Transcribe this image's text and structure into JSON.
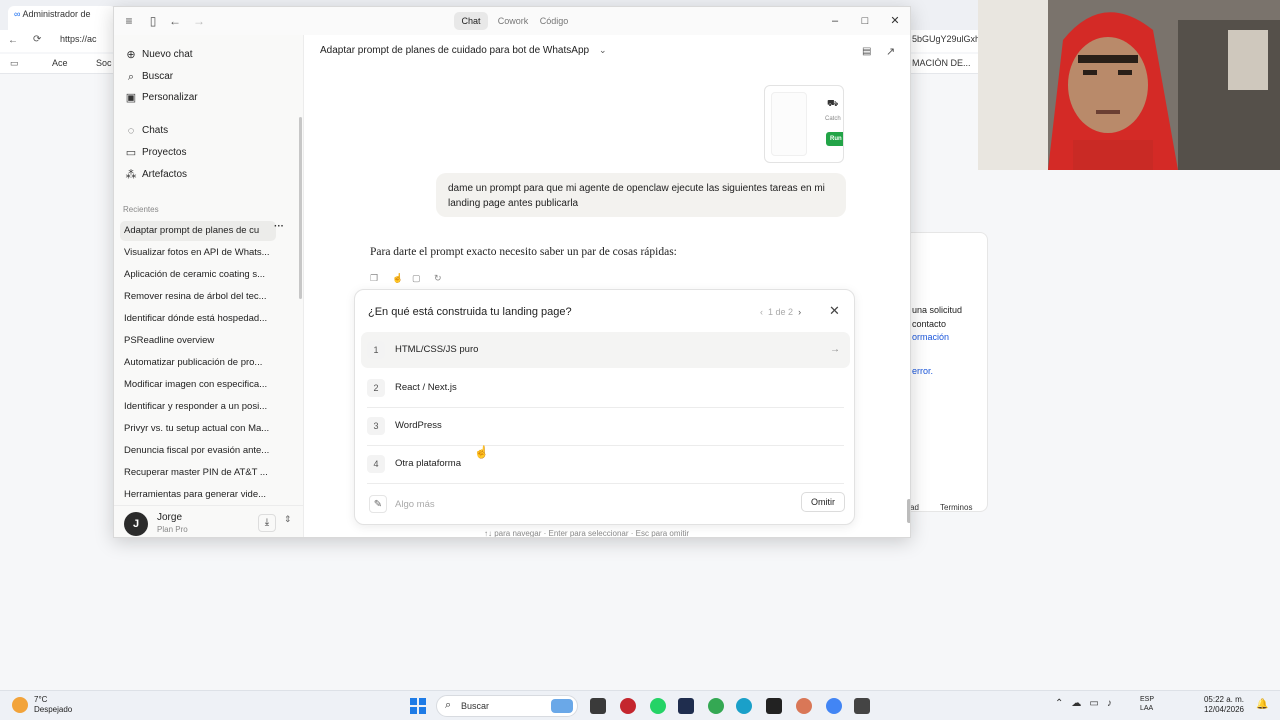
{
  "background_browser": {
    "tab_title": "Administrador de",
    "url_text": "https://ac",
    "url_text_right": "5bGUgY29ulGxh",
    "bookmark_left_1": "Ace",
    "bookmark_left_2": "Soc",
    "bookmark_right": "MACIÓN DE...",
    "card_lines": [
      "una solicitud",
      "contacto",
      "ormación",
      "error."
    ],
    "footer_left": "ad",
    "footer_right": "Terminos"
  },
  "app": {
    "segments": [
      "Chat",
      "Cowork",
      "Código"
    ],
    "sidebar": {
      "nav": [
        {
          "label": "Nuevo chat",
          "icon": "plus-icon"
        },
        {
          "label": "Buscar",
          "icon": "search-icon"
        },
        {
          "label": "Personalizar",
          "icon": "briefcase-icon"
        },
        {
          "label": "Chats",
          "icon": "chat-icon"
        },
        {
          "label": "Proyectos",
          "icon": "folder-icon"
        },
        {
          "label": "Artefactos",
          "icon": "artifacts-icon"
        }
      ],
      "recents_label": "Recientes",
      "recents": [
        "Adaptar prompt de planes de cu",
        "Visualizar fotos en API de Whats...",
        "Aplicación de ceramic coating s...",
        "Remover resina de árbol del tec...",
        "Identificar dónde está hospedad...",
        "PSReadline overview",
        "Automatizar publicación de pro...",
        "Modificar imagen con especifica...",
        "Identificar y responder a un posi...",
        "Privyr vs. tu setup actual con Ma...",
        "Denuncia fiscal por evasión ante...",
        "Recuperar master PIN de AT&T ...",
        "Herramientas para generar vide..."
      ],
      "user": {
        "initial": "J",
        "name": "Jorge",
        "plan": "Plan Pro"
      }
    },
    "main": {
      "title": "Adaptar prompt de planes de cuidado para bot de WhatsApp",
      "artifact": {
        "catch_text": "Catch",
        "run_label": "Run"
      },
      "user_message": "dame un prompt para que mi agente de openclaw ejecute las siguientes tareas en mi landing page antes publicarla",
      "assistant_text": "Para darte el prompt exacto necesito saber un par de cosas rápidas:",
      "question": {
        "title": "¿En qué está construida tu landing page?",
        "pager": "1 de 2",
        "options": [
          {
            "num": "1",
            "label": "HTML/CSS/JS puro"
          },
          {
            "num": "2",
            "label": "React / Next.js"
          },
          {
            "num": "3",
            "label": "WordPress"
          },
          {
            "num": "4",
            "label": "Otra plataforma"
          }
        ],
        "other_placeholder": "Algo más",
        "skip_label": "Omitir"
      },
      "hints": "↑↓ para navegar · Enter para seleccionar · Esc para omitir"
    }
  },
  "taskbar": {
    "weather_temp": "7°C",
    "weather_desc": "Despejado",
    "search_label": "Buscar",
    "lang_line1": "ESP",
    "lang_line2": "LAA",
    "time": "05:22 a. m.",
    "date": "12/04/2026"
  },
  "colors": {
    "accent_run": "#22a447",
    "webcam_hood": "#d42a26",
    "start_blue": "#1e7be6"
  }
}
